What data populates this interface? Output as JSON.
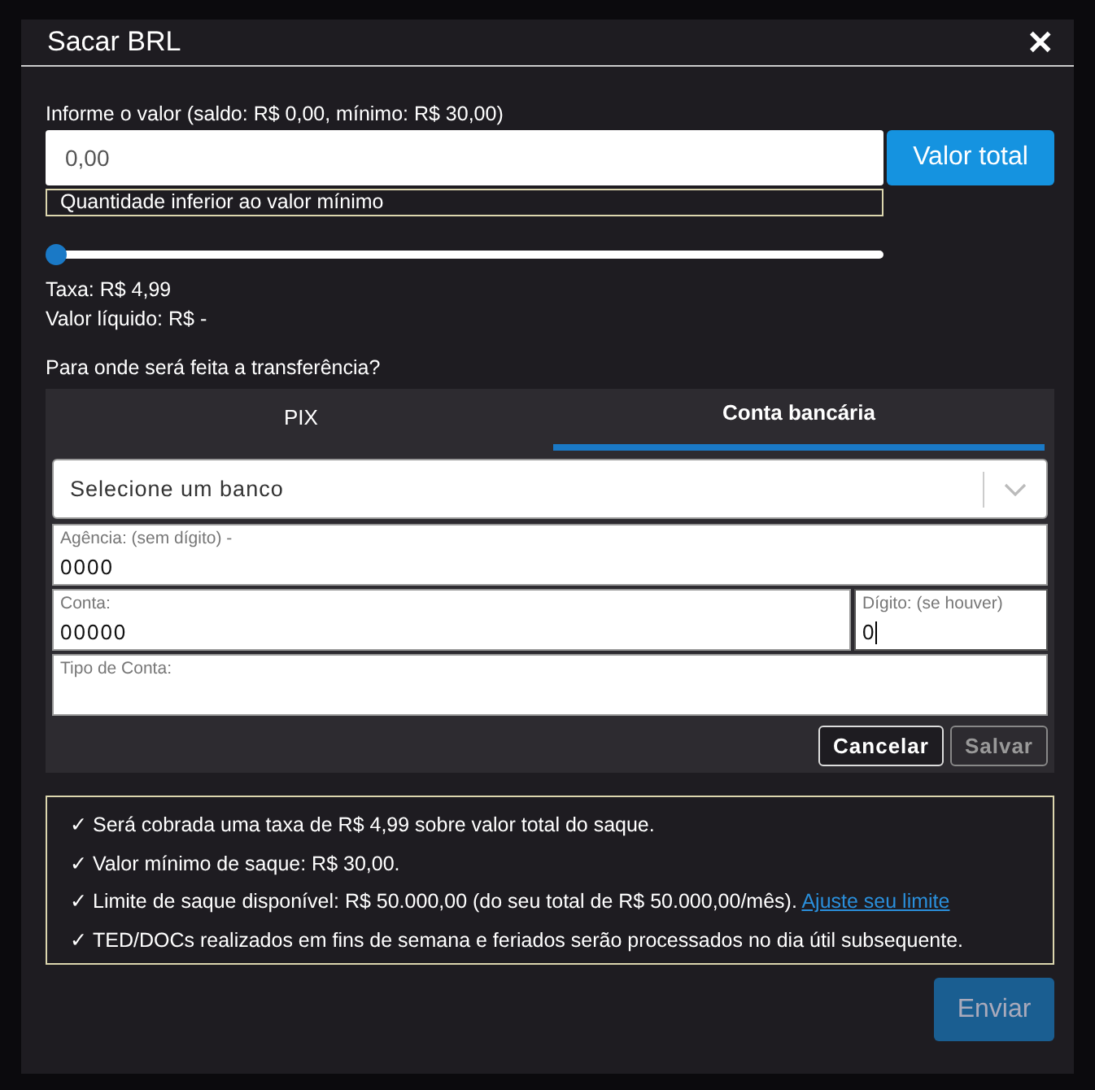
{
  "dialog": {
    "title": "Sacar BRL",
    "close": "✕"
  },
  "amount": {
    "label": "Informe o valor (saldo: R$ 0,00, mínimo: R$ 30,00)",
    "value": "0,00",
    "max_button": "Valor total",
    "error": "Quantidade inferior ao valor mínimo",
    "level": 0
  },
  "fee": "Taxa: R$ 4,99",
  "net": "Valor líquido: R$ -",
  "destination": {
    "question": "Para onde será feita a transferência?",
    "tabs": [
      {
        "label": "PIX",
        "selected": false
      },
      {
        "label": "Conta bancária",
        "selected": true
      }
    ],
    "bank_select": {
      "placeholder": "Selecione um banco"
    },
    "fields": [
      {
        "label": "Agência: (sem dígito) -",
        "value": "0000",
        "focused": false
      },
      {
        "label": "Conta:",
        "value": "00000",
        "focused": false
      },
      {
        "label": "Dígito: (se houver)",
        "value": "0",
        "focused": true
      },
      {
        "label": "Tipo de Conta:",
        "focused": false
      }
    ],
    "buttons": [
      {
        "label": "Cancelar",
        "disabled": false
      },
      {
        "label": "Salvar",
        "disabled": true
      }
    ]
  },
  "notes": [
    {
      "check": "✓",
      "text": "Será cobrada uma taxa de R$ 4,99 sobre valor total do saque."
    },
    {
      "check": "✓",
      "text": "Valor mínimo de saque: R$ 30,00."
    },
    {
      "check": "✓",
      "text": "Limite de saque disponível: R$ 50.000,00 (do seu total de R$ 50.000,00/mês).",
      "link": "Ajuste seu limite"
    },
    {
      "check": "✓",
      "text": "TED/DOCs realizados em fins de semana e feriados serão processados no dia útil subsequente."
    }
  ],
  "submit": {
    "label": "Enviar",
    "disabled": true
  }
}
